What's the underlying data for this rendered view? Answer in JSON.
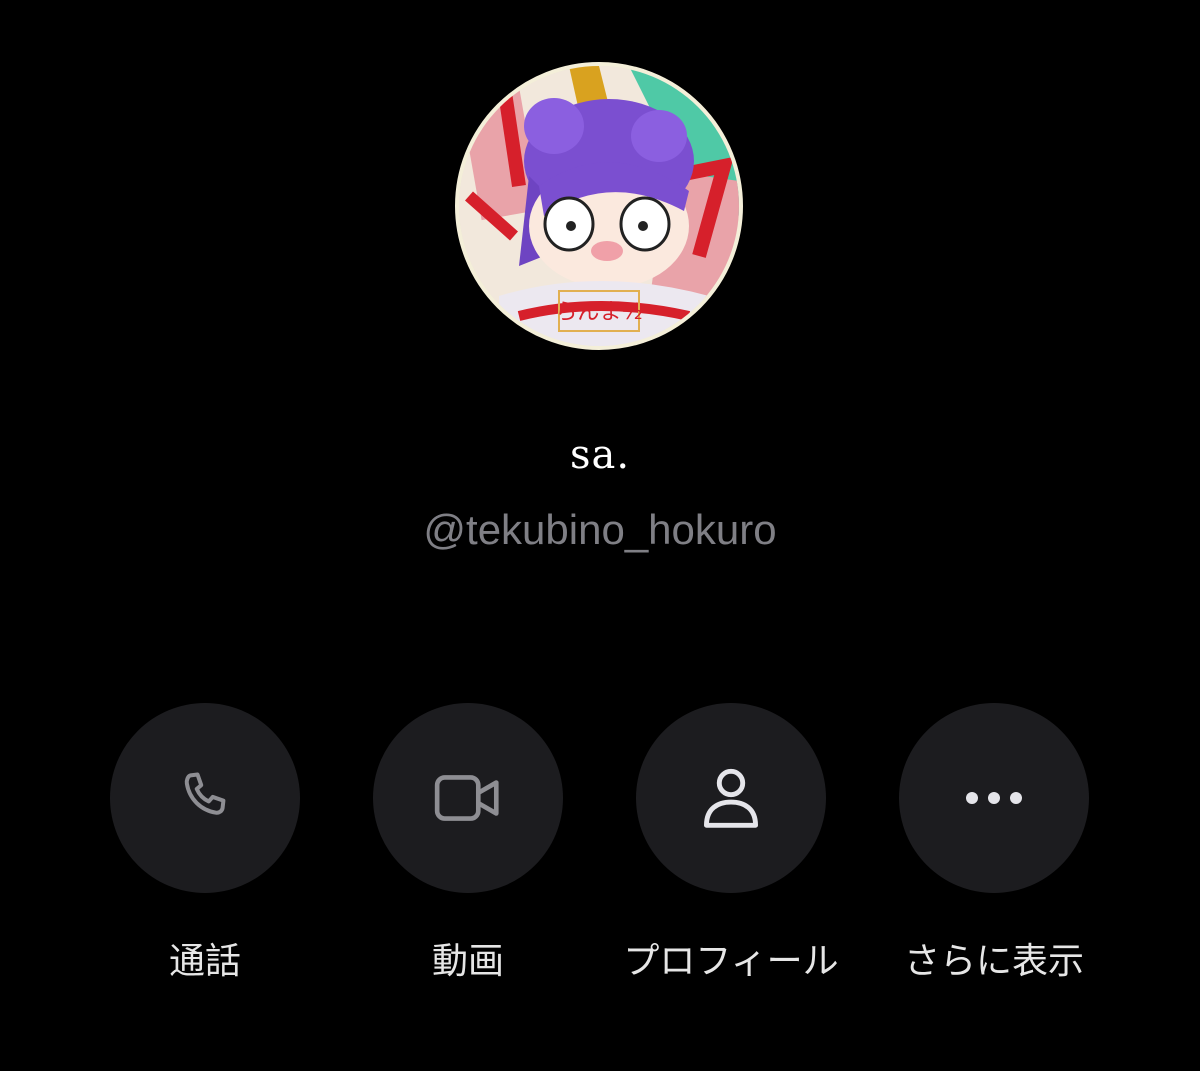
{
  "profile": {
    "display_name": "sa.",
    "handle": "@tekubino_hokuro",
    "avatar_logo_text": "らんま½"
  },
  "actions": [
    {
      "id": "call",
      "icon": "phone-icon",
      "label": "通話"
    },
    {
      "id": "video",
      "icon": "video-camera-icon",
      "label": "動画"
    },
    {
      "id": "profile",
      "icon": "person-icon",
      "label": "プロフィール"
    },
    {
      "id": "more",
      "icon": "more-dots-icon",
      "label": "さらに表示"
    }
  ],
  "colors": {
    "background": "#000000",
    "action_button_bg": "#1c1c1f",
    "icon_muted": "#8e8e93",
    "icon_active": "#e5e5ea",
    "handle_text": "#7f7f85",
    "label_text": "#e6e6e6"
  }
}
